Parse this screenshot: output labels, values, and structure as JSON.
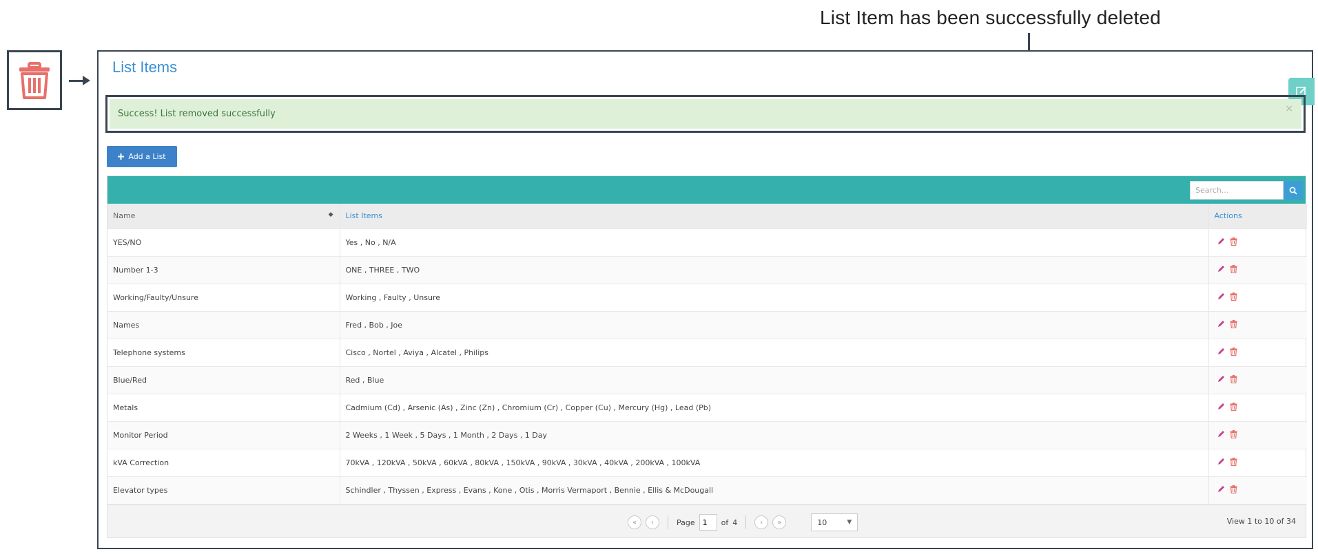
{
  "annotation": {
    "text": "List Item has been successfully deleted"
  },
  "page": {
    "title": "List Items"
  },
  "alert": {
    "text": "Success! List removed successfully",
    "close": "×"
  },
  "toolbar": {
    "add_label": "Add a List"
  },
  "search": {
    "placeholder": "Search..."
  },
  "table": {
    "headers": {
      "name": "Name",
      "items": "List Items",
      "actions": "Actions"
    },
    "rows": [
      {
        "name": "YES/NO",
        "items": "Yes , No , N/A"
      },
      {
        "name": "Number 1-3",
        "items": "ONE , THREE , TWO"
      },
      {
        "name": "Working/Faulty/Unsure",
        "items": "Working , Faulty , Unsure"
      },
      {
        "name": "Names",
        "items": "Fred , Bob , Joe"
      },
      {
        "name": "Telephone systems",
        "items": "Cisco , Nortel , Aviya , Alcatel , Philips"
      },
      {
        "name": "Blue/Red",
        "items": "Red , Blue"
      },
      {
        "name": "Metals",
        "items": "Cadmium (Cd) , Arsenic (As) , Zinc (Zn) , Chromium (Cr) , Copper (Cu) , Mercury (Hg) , Lead (Pb)"
      },
      {
        "name": "Monitor Period",
        "items": "2 Weeks , 1 Week , 5 Days , 1 Month , 2 Days , 1 Day"
      },
      {
        "name": "kVA Correction",
        "items": "70kVA , 120kVA , 50kVA , 60kVA , 80kVA , 150kVA , 90kVA , 30kVA , 40kVA , 200kVA , 100kVA"
      },
      {
        "name": "Elevator types",
        "items": "Schindler , Thyssen , Express , Evans , Kone , Otis , Morris Vermaport , Bennie , Ellis & McDougall"
      }
    ]
  },
  "pager": {
    "page_label": "Page",
    "page_value": "1",
    "of_label": "of",
    "total_pages": "4",
    "per_page": "10",
    "summary": "View 1 to 10 of 34"
  },
  "colors": {
    "teal": "#35b0ac",
    "primary": "#3d82c8",
    "success_bg": "#dff0d8",
    "success_text": "#3c763d",
    "delete": "#e8706a",
    "edit": "#c8408f"
  }
}
